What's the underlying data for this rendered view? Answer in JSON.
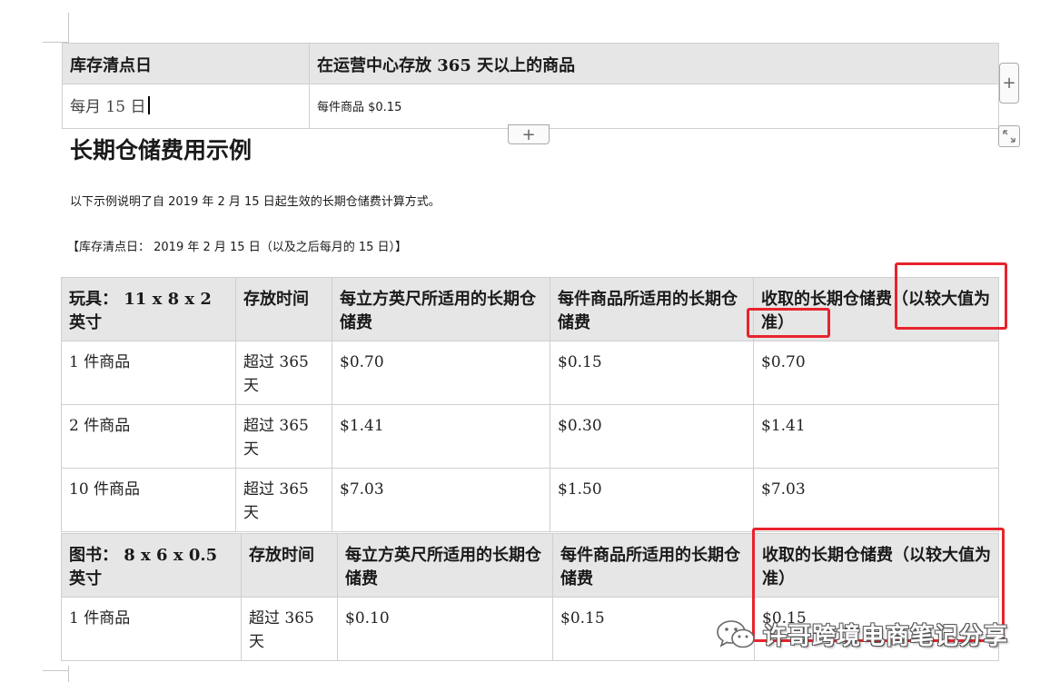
{
  "top_table": {
    "header": [
      "库存清点日",
      "在运营中心存放 365 天以上的商品"
    ],
    "row": [
      "每月 15 日",
      "每件商品 $0.15"
    ]
  },
  "controls": {
    "add_row_label": "+",
    "add_col_label": "+",
    "resize_icon": "resize-icon"
  },
  "section": {
    "title": "长期仓储费用示例",
    "intro": "以下示例说明了自 2019 年 2 月 15 日起生效的长期仓储费计算方式。",
    "note": "【库存清点日： 2019 年 2 月 15 日（以及之后每月的 15 日）】"
  },
  "toy_table": {
    "headers": [
      "玩具： 11 x 8 x 2 英寸",
      "存放时间",
      "每立方英尺所适用的长期仓储费",
      "每件商品所适用的长期仓储费",
      "收取的长期仓储费（以较大值为准）"
    ],
    "rows": [
      [
        "1 件商品",
        "超过 365 天",
        "$0.70",
        "$0.15",
        "$0.70"
      ],
      [
        "2 件商品",
        "超过 365 天",
        "$1.41",
        "$0.30",
        "$1.41"
      ],
      [
        "10 件商品",
        "超过 365 天",
        "$7.03",
        "$1.50",
        "$7.03"
      ]
    ]
  },
  "book_table": {
    "headers": [
      "图书： 8 x 6 x 0.5 英寸",
      "存放时间",
      "每立方英尺所适用的长期仓储费",
      "每件商品所适用的长期仓储费",
      "收取的长期仓储费（以较大值为准）"
    ],
    "rows": [
      [
        "1 件商品",
        "超过 365 天",
        "$0.10",
        "$0.15",
        "$0.15"
      ]
    ]
  },
  "watermark": {
    "icon": "wechat-icon",
    "text": "许哥跨境电商笔记分享"
  },
  "colors": {
    "highlight": "#e8232d",
    "header_bg": "#e6e6e6"
  }
}
